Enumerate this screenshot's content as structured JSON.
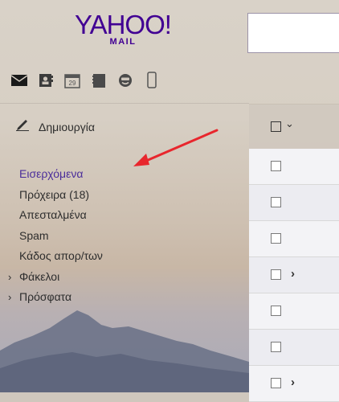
{
  "logo": {
    "main": "YAHOO!",
    "sub": "MAIL"
  },
  "icons": [
    "mail-icon",
    "contacts-icon",
    "calendar-icon",
    "notepad-icon",
    "messenger-icon",
    "mobile-icon"
  ],
  "calendar_day": "29",
  "compose": {
    "label": "Δημιουργία",
    "icon": "pencil-icon"
  },
  "nav": {
    "inbox": "Εισερχόμενα",
    "drafts": "Πρόχειρα (18)",
    "sent": "Απεσταλμένα",
    "spam": "Spam",
    "trash": "Κάδος απορ/των",
    "folders": "Φάκελοι",
    "recent": "Πρόσφατα"
  },
  "colors": {
    "brand": "#410093",
    "active": "#4a2d9a",
    "annotation": "#e8262d"
  }
}
